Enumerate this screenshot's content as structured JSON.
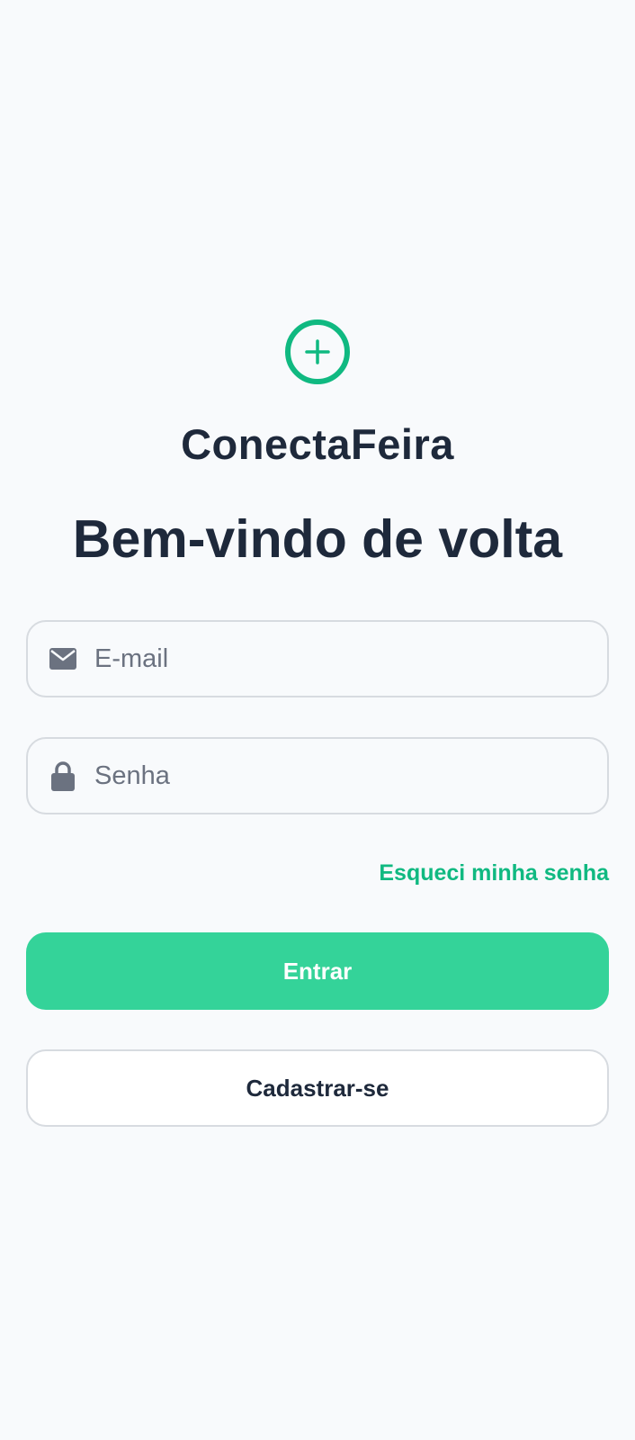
{
  "app": {
    "name": "ConectaFeira",
    "logo_icon": "plus-circle-icon",
    "accent_color": "#10b981"
  },
  "login": {
    "title": "Bem-vindo de volta",
    "email": {
      "icon": "mail-icon",
      "placeholder": "E-mail",
      "value": ""
    },
    "password": {
      "icon": "lock-icon",
      "placeholder": "Senha",
      "value": ""
    },
    "forgot_password_label": "Esqueci minha senha",
    "submit_label": "Entrar",
    "register_label": "Cadastrar-se"
  },
  "colors": {
    "primary_button": "#34d399",
    "link": "#10b981",
    "text": "#1e293b",
    "placeholder": "#6b7280"
  }
}
